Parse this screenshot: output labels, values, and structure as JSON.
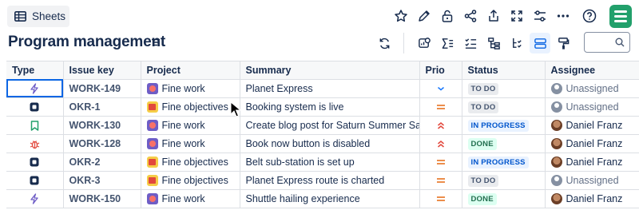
{
  "toolbar": {
    "sheets_label": "Sheets",
    "top_icons": [
      "star-icon",
      "edit-icon",
      "lock-icon",
      "share-icon",
      "export-icon",
      "fullscreen-icon",
      "settings-sliders-icon",
      "more-icon",
      "help-icon"
    ],
    "brand_color": "#22a06b"
  },
  "page": {
    "title": "Program management"
  },
  "tools": [
    "refresh-icon",
    "insights-icon",
    "sum-icon",
    "checklist-icon",
    "hierarchy-icon",
    "tree-icon",
    "row-height-icon",
    "format-paint-icon"
  ],
  "search": {
    "placeholder": ""
  },
  "table": {
    "columns": [
      "Type",
      "Issue key",
      "Project",
      "Summary",
      "Prio",
      "Status",
      "Assignee"
    ],
    "rows": [
      {
        "type": "epic",
        "key": "WORK-149",
        "project": "Fine work",
        "project_kind": "work",
        "summary": "Planet Express",
        "prio": "low",
        "status": "TO DO",
        "status_kind": "todo",
        "assignee": "Unassigned",
        "assignee_kind": "empty"
      },
      {
        "type": "objective",
        "key": "OKR-1",
        "project": "Fine objectives",
        "project_kind": "obj",
        "summary": "Booking system is live",
        "prio": "medium",
        "status": "TO DO",
        "status_kind": "todo",
        "assignee": "Unassigned",
        "assignee_kind": "empty"
      },
      {
        "type": "story",
        "key": "WORK-130",
        "project": "Fine work",
        "project_kind": "work",
        "summary": "Create blog post for Saturn Summer Sale",
        "prio": "high",
        "status": "IN PROGRESS",
        "status_kind": "progress",
        "assignee": "Daniel Franz",
        "assignee_kind": "person"
      },
      {
        "type": "bug",
        "key": "WORK-128",
        "project": "Fine work",
        "project_kind": "work",
        "summary": "Book now button is disabled",
        "prio": "high",
        "status": "DONE",
        "status_kind": "done",
        "assignee": "Daniel Franz",
        "assignee_kind": "person"
      },
      {
        "type": "objective",
        "key": "OKR-2",
        "project": "Fine objectives",
        "project_kind": "obj",
        "summary": "Belt sub-station is set up",
        "prio": "medium",
        "status": "IN PROGRESS",
        "status_kind": "progress",
        "assignee": "Daniel Franz",
        "assignee_kind": "person"
      },
      {
        "type": "objective",
        "key": "OKR-3",
        "project": "Fine objectives",
        "project_kind": "obj",
        "summary": "Planet Express route is charted",
        "prio": "medium",
        "status": "TO DO",
        "status_kind": "todo",
        "assignee": "Unassigned",
        "assignee_kind": "empty"
      },
      {
        "type": "epic",
        "key": "WORK-150",
        "project": "Fine work",
        "project_kind": "work",
        "summary": "Shuttle hailing experience",
        "prio": "medium",
        "status": "DONE",
        "status_kind": "done",
        "assignee": "Daniel Franz",
        "assignee_kind": "person"
      }
    ]
  },
  "colors": {
    "accent": "#0c66e4",
    "prio_low": "#1d7afc",
    "prio_medium": "#e56910",
    "prio_high": "#e2483d",
    "story": "#22a06b",
    "bug": "#e2483d",
    "epic": "#6e5dc6"
  }
}
